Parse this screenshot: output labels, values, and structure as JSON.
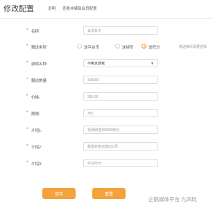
{
  "header": {
    "title": "修改配置",
    "description_label": "说明:",
    "description_text": "查看并编辑会员配置"
  },
  "form": {
    "name": {
      "label": "名称:",
      "placeholder": "会员年卡"
    },
    "gift_type": {
      "label": "赠送类型:",
      "options": [
        "送平台币",
        "送绑币",
        "送积分"
      ],
      "selected": "送积分",
      "hint": "赠送绑币需要选择"
    },
    "game_name": {
      "label": "游戏名称:",
      "value": "不绑定游戏"
    },
    "gift_quantity": {
      "label": "赠送数量:",
      "placeholder": "100000"
    },
    "price": {
      "label": "价格:",
      "placeholder": "365.00"
    },
    "period": {
      "label": "期限:",
      "placeholder": "365"
    },
    "intro1": {
      "label": "介绍1:",
      "placeholder": "领测即送100000积分"
    },
    "intro2": {
      "label": "介绍2:",
      "placeholder": "赠送外签次数5次/月"
    },
    "intro3": {
      "label": "介绍3:",
      "placeholder": "可兑65元"
    }
  },
  "buttons": {
    "save": "保存",
    "reset": "重置"
  },
  "watermark": "企鹅媒体平台 九四玩",
  "colors": {
    "accent": "#f4a23c",
    "required": "#e4393c"
  }
}
